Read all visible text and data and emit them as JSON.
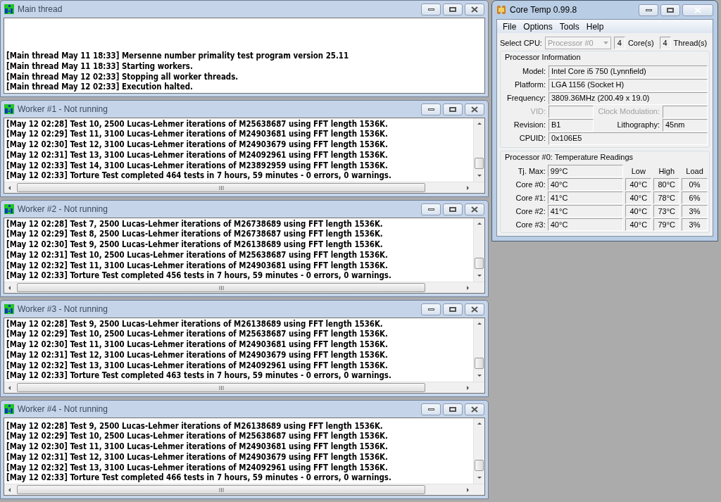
{
  "log_windows": [
    {
      "title": "Main thread",
      "has_scrollbars": false,
      "lines": [
        "[Main thread May 11 18:33] Mersenne number primality test program version 25.11",
        "[Main thread May 11 18:33] Starting workers.",
        "[Main thread May 12 02:33] Stopping all worker threads.",
        "[Main thread May 12 02:33] Execution halted."
      ]
    },
    {
      "title": "Worker #1 - Not running",
      "has_scrollbars": true,
      "lines": [
        "[May 12 02:28] Test 10, 2500 Lucas-Lehmer iterations of M25638687 using FFT length 1536K.",
        "[May 12 02:29] Test 11, 3100 Lucas-Lehmer iterations of M24903681 using FFT length 1536K.",
        "[May 12 02:30] Test 12, 3100 Lucas-Lehmer iterations of M24903679 using FFT length 1536K.",
        "[May 12 02:31] Test 13, 3100 Lucas-Lehmer iterations of M24092961 using FFT length 1536K.",
        "[May 12 02:33] Test 14, 3100 Lucas-Lehmer iterations of M23892959 using FFT length 1536K.",
        "[May 12 02:33] Torture Test completed 464 tests in 7 hours, 59 minutes - 0 errors, 0 warnings."
      ]
    },
    {
      "title": "Worker #2 - Not running",
      "has_scrollbars": true,
      "lines": [
        "[May 12 02:28] Test 7, 2500 Lucas-Lehmer iterations of M26738689 using FFT length 1536K.",
        "[May 12 02:29] Test 8, 2500 Lucas-Lehmer iterations of M26738687 using FFT length 1536K.",
        "[May 12 02:30] Test 9, 2500 Lucas-Lehmer iterations of M26138689 using FFT length 1536K.",
        "[May 12 02:31] Test 10, 2500 Lucas-Lehmer iterations of M25638687 using FFT length 1536K.",
        "[May 12 02:32] Test 11, 3100 Lucas-Lehmer iterations of M24903681 using FFT length 1536K.",
        "[May 12 02:33] Torture Test completed 456 tests in 7 hours, 59 minutes - 0 errors, 0 warnings."
      ]
    },
    {
      "title": "Worker #3 - Not running",
      "has_scrollbars": true,
      "lines": [
        "[May 12 02:28] Test 9, 2500 Lucas-Lehmer iterations of M26138689 using FFT length 1536K.",
        "[May 12 02:29] Test 10, 2500 Lucas-Lehmer iterations of M25638687 using FFT length 1536K.",
        "[May 12 02:30] Test 11, 3100 Lucas-Lehmer iterations of M24903681 using FFT length 1536K.",
        "[May 12 02:31] Test 12, 3100 Lucas-Lehmer iterations of M24903679 using FFT length 1536K.",
        "[May 12 02:32] Test 13, 3100 Lucas-Lehmer iterations of M24092961 using FFT length 1536K.",
        "[May 12 02:33] Torture Test completed 463 tests in 7 hours, 59 minutes - 0 errors, 0 warnings."
      ]
    },
    {
      "title": "Worker #4 - Not running",
      "has_scrollbars": true,
      "lines": [
        "[May 12 02:28] Test 9, 2500 Lucas-Lehmer iterations of M26138689 using FFT length 1536K.",
        "[May 12 02:29] Test 10, 2500 Lucas-Lehmer iterations of M25638687 using FFT length 1536K.",
        "[May 12 02:30] Test 11, 3100 Lucas-Lehmer iterations of M24903681 using FFT length 1536K.",
        "[May 12 02:31] Test 12, 3100 Lucas-Lehmer iterations of M24903679 using FFT length 1536K.",
        "[May 12 02:32] Test 13, 3100 Lucas-Lehmer iterations of M24092961 using FFT length 1536K.",
        "[May 12 02:33] Torture Test completed 466 tests in 7 hours, 59 minutes - 0 errors, 0 warnings."
      ]
    }
  ],
  "core_temp": {
    "title": "Core Temp 0.99.8",
    "menu": [
      "File",
      "Options",
      "Tools",
      "Help"
    ],
    "select_cpu": {
      "label": "Select CPU:",
      "value": "Processor #0",
      "disabled": true
    },
    "cores": {
      "value": "4",
      "label": "Core(s)"
    },
    "threads": {
      "value": "4",
      "label": "Thread(s)"
    },
    "processor_information": {
      "title": "Processor Information",
      "fields": [
        {
          "label": "Model:",
          "value": "Intel Core i5 750 (Lynnfield)",
          "disabled": false
        },
        {
          "label": "Platform:",
          "value": "LGA 1156 (Socket H)",
          "disabled": false
        },
        {
          "label": "Frequency:",
          "value": "3809.36MHz (200.49 x 19.0)",
          "disabled": false
        }
      ],
      "pairs": [
        [
          {
            "label": "VID:",
            "disabled": true
          },
          {
            "label": "Clock Modulation:",
            "disabled": true
          }
        ],
        [
          {
            "label": "Revision:",
            "value": "B1",
            "disabled": false
          },
          {
            "label": "Lithography:",
            "value": "45nm",
            "disabled": false
          }
        ]
      ],
      "cpuid": {
        "label": "CPUID:",
        "value": "0x106E5",
        "disabled": false
      }
    },
    "temperature": {
      "title": "Processor #0: Temperature Readings",
      "tj_max": {
        "label": "Tj. Max:",
        "value": "99°C"
      },
      "columns": [
        "Low",
        "High",
        "Load"
      ],
      "cores": [
        {
          "label": "Core #0:",
          "temp": "40°C",
          "low": "40°C",
          "high": "80°C",
          "load": "0%"
        },
        {
          "label": "Core #1:",
          "temp": "41°C",
          "low": "40°C",
          "high": "78°C",
          "load": "6%"
        },
        {
          "label": "Core #2:",
          "temp": "41°C",
          "low": "40°C",
          "high": "73°C",
          "load": "3%"
        },
        {
          "label": "Core #3:",
          "temp": "40°C",
          "low": "40°C",
          "high": "79°C",
          "load": "3%"
        }
      ]
    }
  }
}
